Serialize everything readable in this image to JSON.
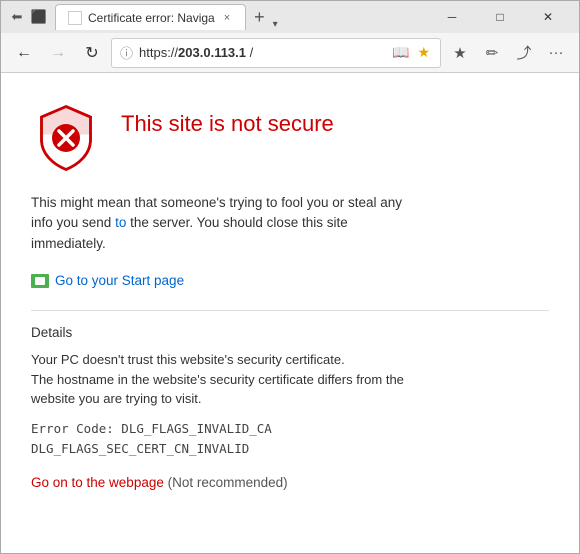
{
  "window": {
    "title": "Certificate error: Naviga",
    "tab_label": "Certificate error: Naviga",
    "close_tab": "×"
  },
  "nav": {
    "back_label": "←",
    "forward_label": "→",
    "refresh_label": "↻",
    "address_protocol": "https://",
    "address_bold": "203.0.113.1",
    "address_rest": " /",
    "lock_icon": "🔒"
  },
  "toolbar": {
    "reading_view": "📖",
    "favorites": "☆",
    "share": "⤴",
    "more": "···"
  },
  "error_page": {
    "title": "This site is not secure",
    "description": "This might mean that someone's trying to fool you or steal any info you send to the server. You should close this site immediately.",
    "description_link_text": "to",
    "start_page_link": "Go to your Start page",
    "details_heading": "Details",
    "details_line1": "Your PC doesn't trust this website's security certificate.",
    "details_line2": "The hostname in the website's security certificate differs from the website you are trying to visit.",
    "error_code_line1": "Error Code:  DLG_FLAGS_INVALID_CA",
    "error_code_line2": "DLG_FLAGS_SEC_CERT_CN_INVALID",
    "go_on_link": "Go on to the webpage",
    "not_recommended": " (Not recommended)"
  },
  "window_controls": {
    "minimize": "─",
    "maximize": "□",
    "close": "✕"
  }
}
